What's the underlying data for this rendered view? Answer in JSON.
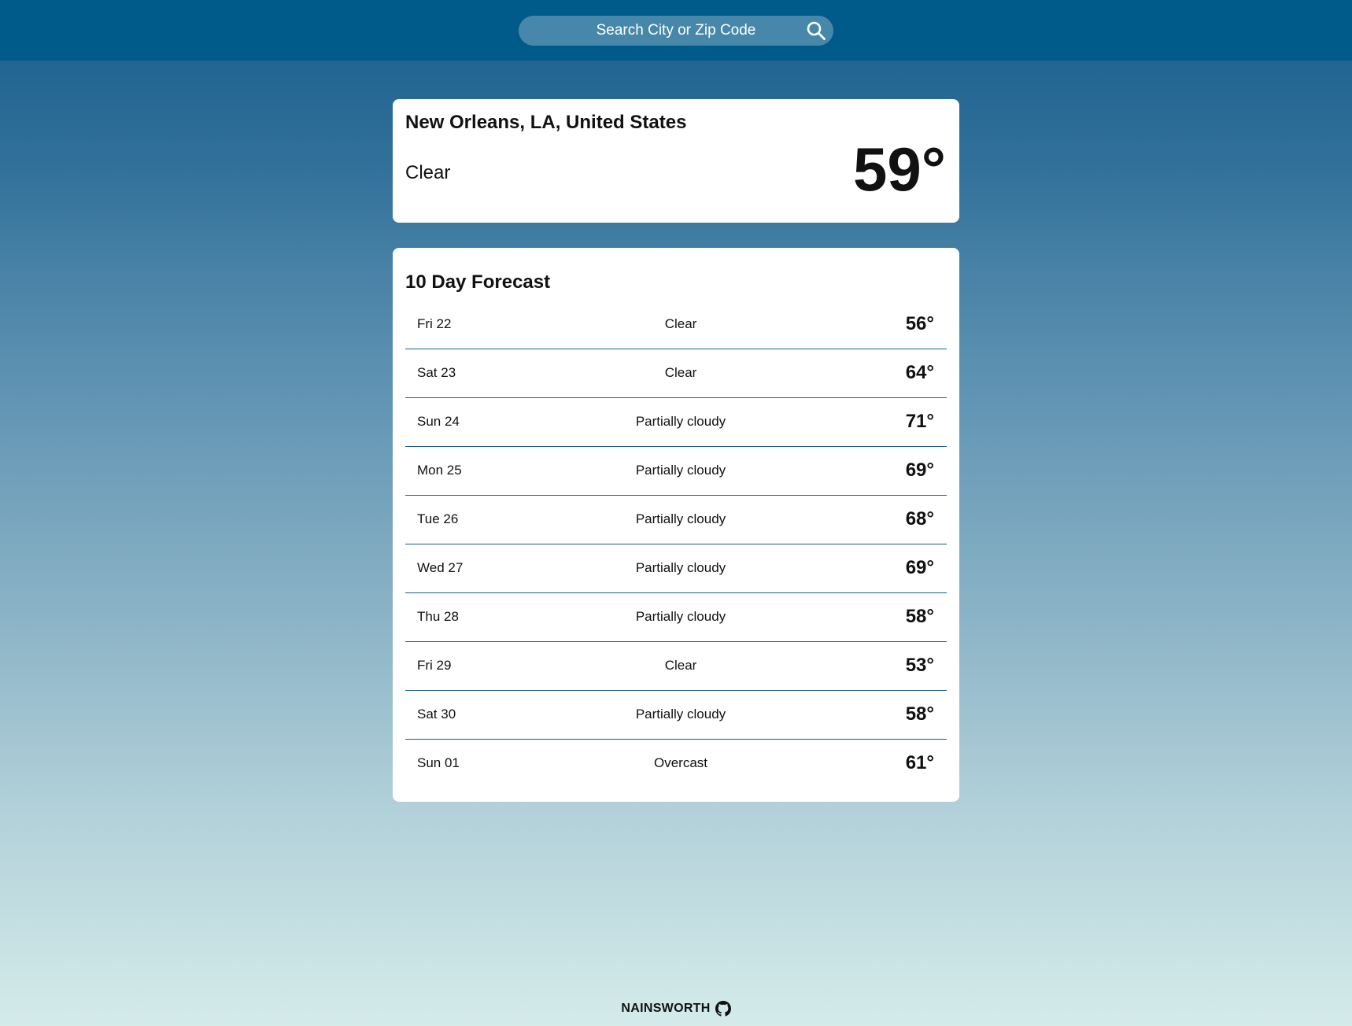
{
  "search": {
    "placeholder": "Search City or Zip Code",
    "icon": "search-icon"
  },
  "current": {
    "location": "New Orleans, LA, United States",
    "condition": "Clear",
    "temperature": "59°"
  },
  "forecast": {
    "title": "10 Day Forecast",
    "days": [
      {
        "day": "Fri 22",
        "condition": "Clear",
        "temp": "56°"
      },
      {
        "day": "Sat 23",
        "condition": "Clear",
        "temp": "64°"
      },
      {
        "day": "Sun 24",
        "condition": "Partially cloudy",
        "temp": "71°"
      },
      {
        "day": "Mon 25",
        "condition": "Partially cloudy",
        "temp": "69°"
      },
      {
        "day": "Tue 26",
        "condition": "Partially cloudy",
        "temp": "68°"
      },
      {
        "day": "Wed 27",
        "condition": "Partially cloudy",
        "temp": "69°"
      },
      {
        "day": "Thu 28",
        "condition": "Partially cloudy",
        "temp": "58°"
      },
      {
        "day": "Fri 29",
        "condition": "Clear",
        "temp": "53°"
      },
      {
        "day": "Sat 30",
        "condition": "Partially cloudy",
        "temp": "58°"
      },
      {
        "day": "Sun 01",
        "condition": "Overcast",
        "temp": "61°"
      }
    ]
  },
  "footer": {
    "author": "NAINSWORTH",
    "icon": "github-icon"
  },
  "colors": {
    "header": "#015b8a",
    "divider": "#1a5e8f",
    "card": "#ffffff"
  }
}
